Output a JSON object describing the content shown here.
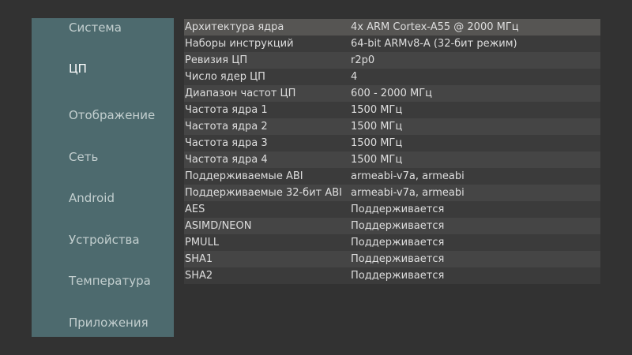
{
  "sidebar": {
    "items": [
      {
        "label": "Система"
      },
      {
        "label": "ЦП"
      },
      {
        "label": "Отображение"
      },
      {
        "label": "Сеть"
      },
      {
        "label": "Android"
      },
      {
        "label": "Устройства"
      },
      {
        "label": "Температура"
      },
      {
        "label": "Приложения"
      }
    ],
    "selected": "ЦП"
  },
  "cpu_table": {
    "rows": [
      {
        "key": "Архитектура ядра",
        "value": "4x ARM Cortex-A55 @ 2000 МГц"
      },
      {
        "key": "Наборы инструкций",
        "value": "64-bit ARMv8-A (32-бит режим)"
      },
      {
        "key": "Ревизия ЦП",
        "value": "r2p0"
      },
      {
        "key": "Число ядер ЦП",
        "value": "4"
      },
      {
        "key": "Диапазон частот ЦП",
        "value": "600 - 2000 МГц"
      },
      {
        "key": "Частота ядра 1",
        "value": "1500 МГц"
      },
      {
        "key": "Частота ядра 2",
        "value": "1500 МГц"
      },
      {
        "key": "Частота ядра 3",
        "value": "1500 МГц"
      },
      {
        "key": "Частота ядра 4",
        "value": "1500 МГц"
      },
      {
        "key": "Поддерживаемые ABI",
        "value": "armeabi-v7a, armeabi"
      },
      {
        "key": "Поддерживаемые 32-бит ABI",
        "value": "armeabi-v7a, armeabi"
      },
      {
        "key": "AES",
        "value": "Поддерживается"
      },
      {
        "key": "ASIMD/NEON",
        "value": "Поддерживается"
      },
      {
        "key": "PMULL",
        "value": "Поддерживается"
      },
      {
        "key": "SHA1",
        "value": "Поддерживается"
      },
      {
        "key": "SHA2",
        "value": "Поддерживается"
      }
    ]
  },
  "colors": {
    "background": "#323232",
    "sidebar": "#4d6a6e",
    "row_highlight": "#565553",
    "text": "#dedede"
  }
}
